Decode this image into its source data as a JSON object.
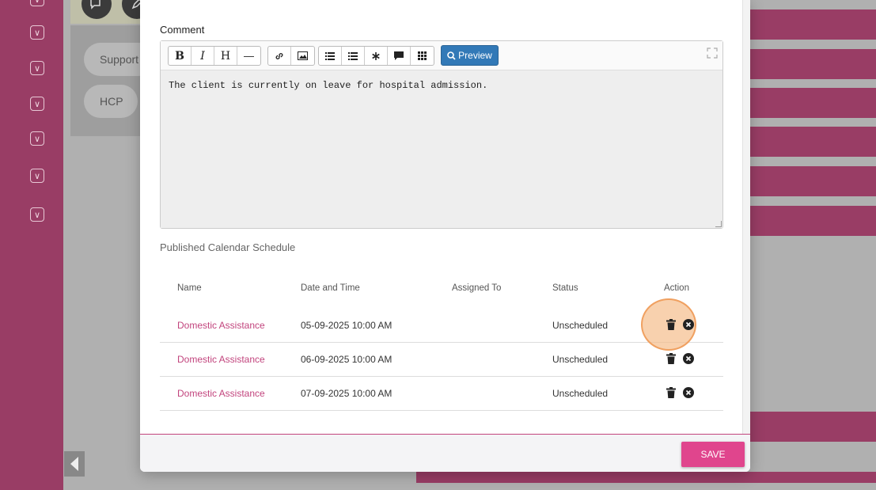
{
  "background": {
    "pills": [
      "Support",
      "HCP"
    ]
  },
  "modal": {
    "comment_label": "Comment",
    "toolbar": {
      "bold": "B",
      "italic": "I",
      "heading": "H",
      "hr": "—",
      "preview_label": "Preview"
    },
    "comment_text": "The client is currently on leave for hospital admission.",
    "schedule_title": "Published Calendar Schedule",
    "table": {
      "headers": [
        "Name",
        "Date and Time",
        "Assigned To",
        "Status",
        "Action"
      ],
      "rows": [
        {
          "name": "Domestic Assistance",
          "datetime": "05-09-2025 10:00 AM",
          "assigned_to": "",
          "status": "Unscheduled"
        },
        {
          "name": "Domestic Assistance",
          "datetime": "06-09-2025 10:00 AM",
          "assigned_to": "",
          "status": "Unscheduled"
        },
        {
          "name": "Domestic Assistance",
          "datetime": "07-09-2025 10:00 AM",
          "assigned_to": "",
          "status": "Unscheduled"
        }
      ]
    },
    "save_label": "SAVE"
  },
  "colors": {
    "brand": "#993d65",
    "accent": "#e0458d",
    "link": "#c2447d",
    "preview_button": "#3279b7"
  }
}
